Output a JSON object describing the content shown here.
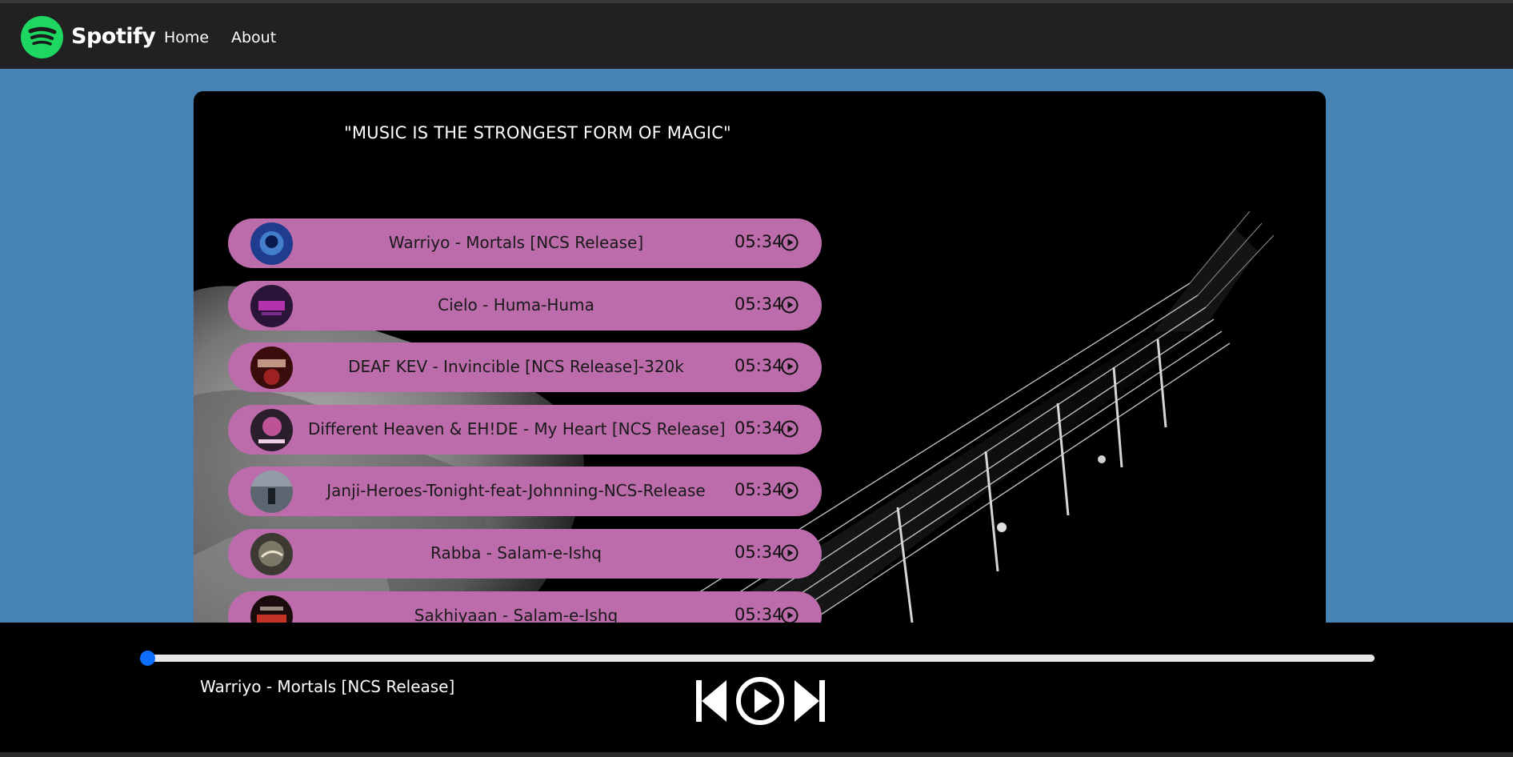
{
  "header": {
    "brand": "Spotify",
    "logo_icon": "spotify-logo-icon",
    "nav": [
      {
        "label": "Home"
      },
      {
        "label": "About"
      }
    ]
  },
  "main": {
    "quote": "\"MUSIC IS THE STRONGEST FORM OF MAGIC\"",
    "songs": [
      {
        "name": "Warriyo - Mortals [NCS Release]",
        "duration": "05:34",
        "cover_color": "#1f3c8f",
        "cover_accent": "#5fb5ff"
      },
      {
        "name": "Cielo - Huma-Huma",
        "duration": "05:34",
        "cover_color": "#2a1538",
        "cover_accent": "#d63acb"
      },
      {
        "name": "DEAF KEV - Invincible [NCS Release]-320k",
        "duration": "05:34",
        "cover_color": "#3a0c0c",
        "cover_accent": "#c92b2b"
      },
      {
        "name": "Different Heaven & EH!DE - My Heart [NCS Release]",
        "duration": "05:34",
        "cover_color": "#2a1e2c",
        "cover_accent": "#e25fb3"
      },
      {
        "name": "Janji-Heroes-Tonight-feat-Johnning-NCS-Release",
        "duration": "05:34",
        "cover_color": "#5c6670",
        "cover_accent": "#c9d2db"
      },
      {
        "name": "Rabba - Salam-e-Ishq",
        "duration": "05:34",
        "cover_color": "#3c3a33",
        "cover_accent": "#a7a18c"
      },
      {
        "name": "Sakhiyaan - Salam-e-Ishq",
        "duration": "05:34",
        "cover_color": "#1a0c0c",
        "cover_accent": "#e23b2b"
      }
    ],
    "play_icon": "play-circle-icon"
  },
  "player": {
    "now_playing": "Warriyo - Mortals [NCS Release]",
    "progress": 0,
    "accent_color": "#0d6efd",
    "controls": {
      "prev_icon": "skip-previous-icon",
      "play_icon": "play-circle-icon",
      "next_icon": "skip-next-icon"
    }
  }
}
